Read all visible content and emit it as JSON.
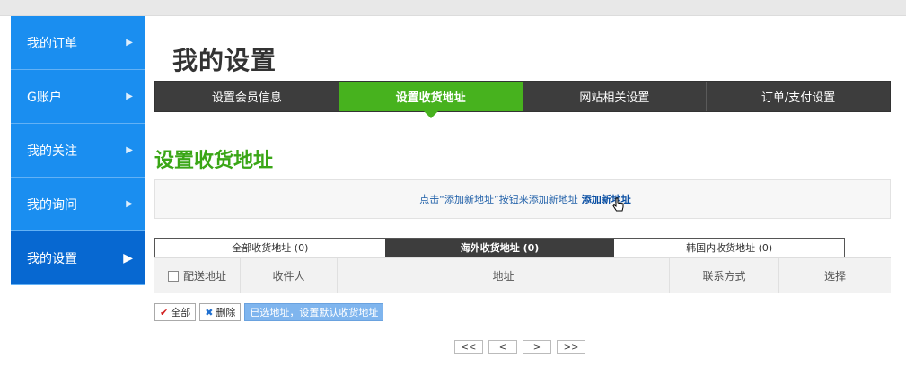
{
  "sidebar": {
    "items": [
      {
        "label": "我的订单"
      },
      {
        "label": "G账户"
      },
      {
        "label": "我的关注"
      },
      {
        "label": "我的询问"
      },
      {
        "label": "我的设置"
      }
    ]
  },
  "page_title": "我的设置",
  "tabs": [
    {
      "label": "设置会员信息"
    },
    {
      "label": "设置收货地址"
    },
    {
      "label": "网站相关设置"
    },
    {
      "label": "订单/支付设置"
    }
  ],
  "section_title": "设置收货地址",
  "notice": {
    "text": "点击“添加新地址”按钮来添加新地址",
    "link": "添加新地址"
  },
  "address_tabs": [
    {
      "label": "全部收货地址 (0)"
    },
    {
      "label": "海外收货地址 (0)"
    },
    {
      "label": "韩国内收货地址 (0)"
    }
  ],
  "table": {
    "headers": {
      "ship_addr": "配送地址",
      "recipient": "收件人",
      "address": "地址",
      "contact": "联系方式",
      "select": "选择"
    }
  },
  "actions": {
    "all": "全部",
    "delete": "删除",
    "set_default": "已选地址，设置默认收货地址"
  },
  "pager": {
    "first": "<<",
    "prev": "<",
    "next": ">",
    "last": ">>"
  },
  "colors": {
    "accent_green": "#47b21e",
    "sidebar_blue": "#1a8ef0",
    "sidebar_active": "#0768d1",
    "tab_dark": "#3d3d3d"
  }
}
